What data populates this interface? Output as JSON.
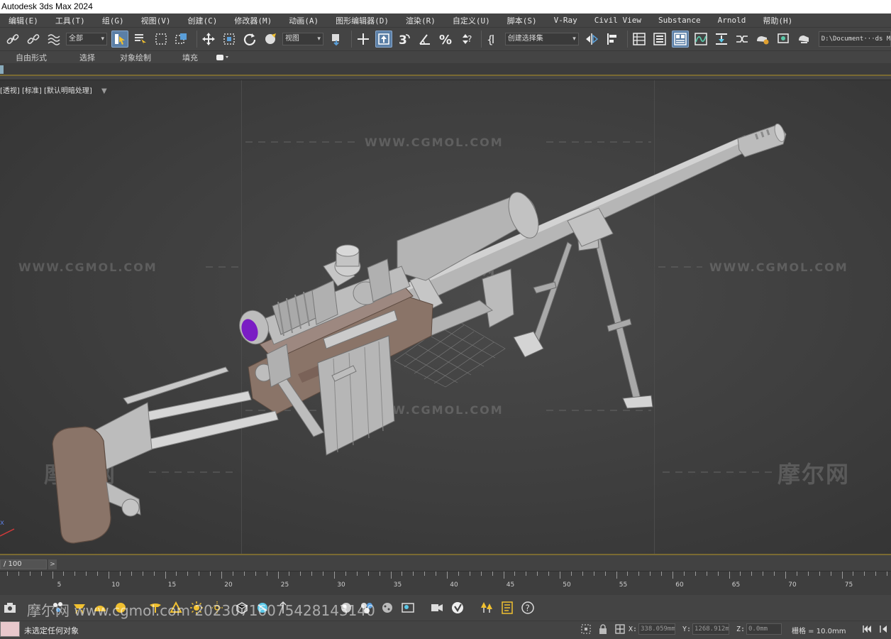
{
  "app": {
    "title": "Autodesk 3ds Max 2024"
  },
  "menu": {
    "items": [
      "编辑(E)",
      "工具(T)",
      "组(G)",
      "视图(V)",
      "创建(C)",
      "修改器(M)",
      "动画(A)",
      "图形编辑器(D)",
      "渲染(R)",
      "自定义(U)",
      "脚本(S)",
      "V-Ray",
      "Civil View",
      "Substance",
      "Arnold",
      "帮助(H)"
    ]
  },
  "toolbar": {
    "selection_filter": "全部",
    "reference_coord": "视图",
    "named_selection_sets": "创建选择集",
    "project_path": "D:\\Document···ds Max"
  },
  "ribbon": {
    "tabs": [
      "自由形式",
      "选择",
      "对象绘制",
      "填充"
    ]
  },
  "viewport": {
    "label_pov": "[透视]",
    "label_shading": "[标准]",
    "label_lighting": "[默认明暗处理]",
    "background_color": "#3e3e3e",
    "model_primary_color": "#b4b4b4",
    "model_wood_color": "#8a7468",
    "lens_color": "#7a1cc4"
  },
  "watermarks": {
    "site_text": "WWW.CGMOL.COM",
    "logo_text": "摩尔网"
  },
  "timeline": {
    "frame_field": "/ 100",
    "next_button": ">",
    "tick_labels": [
      "5",
      "10",
      "15",
      "20",
      "25",
      "30",
      "35",
      "40",
      "45",
      "50",
      "55",
      "60",
      "65",
      "70",
      "75"
    ]
  },
  "bottom_overlay": {
    "text": "摩尔网 www.cgmol.com 202307160754281431​40"
  },
  "status": {
    "selection_text": "未选定任何对象",
    "x_label": "X:",
    "x_value": "338.059mm",
    "y_label": "Y:",
    "y_value": "1268.912m",
    "z_label": "Z:",
    "z_value": "0.0mm",
    "grid_readout": "栅格 = 10.0mm"
  }
}
